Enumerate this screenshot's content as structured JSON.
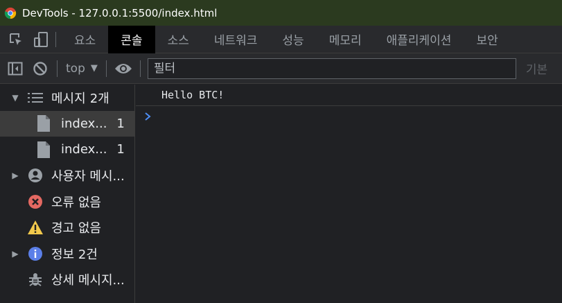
{
  "window": {
    "title": "DevTools - 127.0.0.1:5500/index.html"
  },
  "tabs": [
    {
      "label": "요소",
      "active": false
    },
    {
      "label": "콘솔",
      "active": true
    },
    {
      "label": "소스",
      "active": false
    },
    {
      "label": "네트워크",
      "active": false
    },
    {
      "label": "성능",
      "active": false
    },
    {
      "label": "메모리",
      "active": false
    },
    {
      "label": "애플리케이션",
      "active": false
    },
    {
      "label": "보안",
      "active": false
    }
  ],
  "toolbar": {
    "context": "top",
    "filter_placeholder": "필터",
    "levels_label": "기본"
  },
  "sidebar": {
    "items": [
      {
        "label": "메시지",
        "count": "2개",
        "icon": "list-icon",
        "expanded": true
      },
      {
        "label": "index...",
        "count": "1",
        "icon": "file-icon",
        "selected": true
      },
      {
        "label": "index...",
        "count": "1",
        "icon": "file-icon"
      },
      {
        "label": "사용자 메시...",
        "icon": "user-icon"
      },
      {
        "label": "오류 없음",
        "icon": "error-icon"
      },
      {
        "label": "경고 없음",
        "icon": "warning-icon"
      },
      {
        "label": "정보 2건",
        "icon": "info-icon"
      },
      {
        "label": "상세 메시지...",
        "icon": "bug-icon"
      }
    ]
  },
  "console": {
    "messages": [
      "Hello BTC!"
    ]
  },
  "colors": {
    "accent": "#1a73e8",
    "error": "#e46962",
    "warning": "#f2c94c",
    "info": "#5b7fe8"
  }
}
